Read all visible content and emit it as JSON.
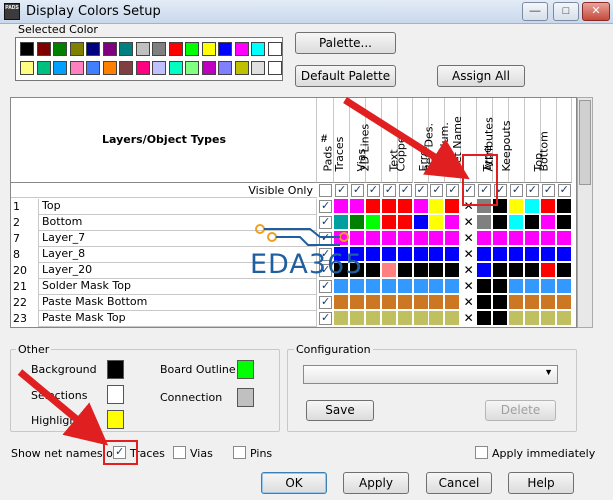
{
  "window": {
    "app_icon_text": "PADS",
    "title": "Display Colors Setup",
    "minimize_glyph": "—",
    "maximize_glyph": "□",
    "close_glyph": "✕"
  },
  "selected_color": {
    "label": "Selected Color",
    "palette_row1": [
      "#000000",
      "#800000",
      "#008000",
      "#808000",
      "#000080",
      "#800080",
      "#008080",
      "#c0c0c0",
      "#808080",
      "#ff0000",
      "#00ff00",
      "#ffff00",
      "#0000ff",
      "#ff00ff",
      "#00ffff",
      "#ffffff"
    ],
    "palette_row2": [
      "#ffff80",
      "#00c080",
      "#00a0ff",
      "#ff80c0",
      "#4080ff",
      "#ff8000",
      "#804040",
      "#ff0080",
      "#c0c0ff",
      "#00ffc0",
      "#80ff80",
      "#c000c0",
      "#8080ff",
      "#c0c000",
      "#e0e0e0",
      "#ffffff"
    ]
  },
  "buttons": {
    "palette": "Palette...",
    "default_palette": "Default Palette",
    "assign_all": "Assign All",
    "save": "Save",
    "delete": "Delete",
    "ok": "OK",
    "apply": "Apply",
    "cancel": "Cancel",
    "help": "Help"
  },
  "grid": {
    "header_title": "Layers/Object Types",
    "hash_label": "#",
    "visible_only_label": "Visible Only",
    "columns": [
      "Pads",
      "Traces",
      "Vias",
      "2D Lines",
      "Text",
      "Copper",
      "Error",
      "Ref. Des.",
      "Pin Num.",
      "Net Name",
      "Type",
      "Attributes",
      "Keepouts",
      "Top",
      "Bottom"
    ],
    "rows": [
      {
        "num": "1",
        "name": "Top",
        "colors": [
          "#ff00ff",
          "#ff00ff",
          "#ff0000",
          "#ff0000",
          "#ff0000",
          "#ff00ff",
          "#ffff00",
          "#ff0000",
          "X",
          "#808080",
          "#000000",
          "#ffff00",
          "#00ffff",
          "#ff0000",
          "#000000"
        ]
      },
      {
        "num": "2",
        "name": "Bottom",
        "colors": [
          "#00a0a0",
          "#008000",
          "#00ff00",
          "#ff0000",
          "#ff0000",
          "#0000ff",
          "#ffff00",
          "#ff00ff",
          "X",
          "#808080",
          "#000000",
          "#00ffff",
          "#000000",
          "#ff00ff",
          "#000000"
        ]
      },
      {
        "num": "7",
        "name": "Layer_7",
        "colors": [
          "#ff00ff",
          "#ff00ff",
          "#ff00ff",
          "#ff00ff",
          "#ff00ff",
          "#ff00ff",
          "#ff00ff",
          "#ff00ff",
          "X",
          "#ff00ff",
          "#ff00ff",
          "#ff00ff",
          "#ff00ff",
          "#ff00ff",
          "#ff00ff"
        ]
      },
      {
        "num": "8",
        "name": "Layer_8",
        "colors": [
          "#0000ff",
          "#0000ff",
          "#0000ff",
          "#0000ff",
          "#0000ff",
          "#0000ff",
          "#0000ff",
          "#0000ff",
          "X",
          "#0000ff",
          "#0000ff",
          "#0000ff",
          "#0000ff",
          "#0000ff",
          "#0000ff"
        ]
      },
      {
        "num": "20",
        "name": "Layer_20",
        "colors": [
          "#000000",
          "#000000",
          "#000000",
          "#ff8080",
          "#000000",
          "#000000",
          "#000000",
          "#000000",
          "X",
          "#0000ff",
          "#000000",
          "#000000",
          "#000000",
          "#ff0000",
          "#000000"
        ]
      },
      {
        "num": "21",
        "name": "Solder Mask Top",
        "colors": [
          "#3399ff",
          "#3399ff",
          "#3399ff",
          "#3399ff",
          "#3399ff",
          "#3399ff",
          "#3399ff",
          "#3399ff",
          "X",
          "#000000",
          "#000000",
          "#3399ff",
          "#3399ff",
          "#3399ff",
          "#3399ff"
        ]
      },
      {
        "num": "22",
        "name": "Paste Mask Bottom",
        "colors": [
          "#cc7722",
          "#cc7722",
          "#cc7722",
          "#cc7722",
          "#cc7722",
          "#cc7722",
          "#cc7722",
          "#cc7722",
          "X",
          "#000000",
          "#000000",
          "#cc7722",
          "#cc7722",
          "#cc7722",
          "#cc7722"
        ]
      },
      {
        "num": "23",
        "name": "Paste Mask Top",
        "colors": [
          "#c0c060",
          "#c0c060",
          "#c0c060",
          "#c0c060",
          "#c0c060",
          "#c0c060",
          "#c0c060",
          "#c0c060",
          "X",
          "#000000",
          "#000000",
          "#c0c060",
          "#c0c060",
          "#c0c060",
          "#c0c060"
        ]
      }
    ]
  },
  "other": {
    "label": "Other",
    "background_label": "Background",
    "background_color": "#000000",
    "selections_label": "Selections",
    "selections_color": "#ffffff",
    "highlight_label": "Highlight",
    "highlight_color": "#ffff00",
    "board_outline_label": "Board Outline",
    "board_outline_color": "#00ff00",
    "connection_label": "Connection",
    "connection_color": "#c0c0c0"
  },
  "configuration": {
    "label": "Configuration",
    "dropdown_value": ""
  },
  "net_names": {
    "label": "Show net names on",
    "traces_label": "Traces",
    "traces_checked": true,
    "vias_label": "Vias",
    "vias_checked": false,
    "pins_label": "Pins",
    "pins_checked": false
  },
  "apply_immediately": {
    "label": "Apply immediately",
    "checked": false
  },
  "watermark": {
    "text": "EDA365"
  }
}
